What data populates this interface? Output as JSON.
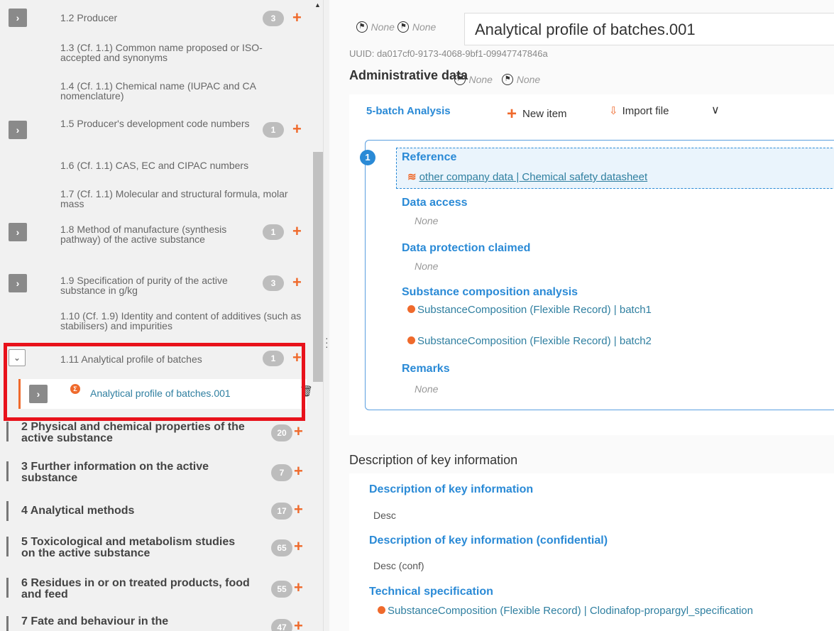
{
  "tree": {
    "nodes": [
      {
        "id": "n12",
        "label": "1.2 Producer",
        "count": "3",
        "expandable": true
      },
      {
        "id": "n13",
        "label": "1.3 (Cf. 1.1) Common name proposed or ISO-accepted and synonyms"
      },
      {
        "id": "n14",
        "label": "1.4 (Cf. 1.1) Chemical name (IUPAC and CA nomenclature)"
      },
      {
        "id": "n15",
        "label": "1.5 Producer's development code numbers",
        "count": "1",
        "expandable": true
      },
      {
        "id": "n16",
        "label": "1.6 (Cf. 1.1) CAS, EC and CIPAC numbers"
      },
      {
        "id": "n17",
        "label": "1.7 (Cf. 1.1) Molecular and structural formula, molar mass"
      },
      {
        "id": "n18",
        "label": "1.8 Method of manufacture (synthesis pathway) of the active substance",
        "count": "1",
        "expandable": true
      },
      {
        "id": "n19",
        "label": "1.9 Specification of purity of the active substance in g/kg",
        "count": "3",
        "expandable": true
      },
      {
        "id": "n110",
        "label": "1.10 (Cf. 1.9) Identity and content of additives (such as stabilisers) and impurities"
      },
      {
        "id": "n111",
        "label": "1.11 Analytical profile of batches",
        "count": "1",
        "expandable": true,
        "open": true
      }
    ],
    "child": {
      "label": "Analytical profile of batches.001",
      "icon": "sigma-icon"
    },
    "sections": [
      {
        "label": "2 Physical and chemical properties of the active substance",
        "count": "20"
      },
      {
        "label": "3 Further information on the active substance",
        "count": "7"
      },
      {
        "label": "4 Analytical methods",
        "count": "17"
      },
      {
        "label": "5 Toxicological and metabolism studies on the active substance",
        "count": "65"
      },
      {
        "label": "6 Residues in or on treated products, food and feed",
        "count": "55"
      },
      {
        "label": "7 Fate and behaviour in the",
        "count": "47"
      }
    ]
  },
  "header": {
    "flag1": "None",
    "flag2": "None",
    "title": "Analytical profile of batches.001",
    "uuid": "UUID: da017cf0-9173-4068-9bf1-09947747846a"
  },
  "admin": {
    "title": "Administrative data",
    "flag1": "None",
    "flag2": "None",
    "tab": "5-batch Analysis",
    "new_item": "New item",
    "import_file": "Import file",
    "entry_number": "1",
    "reference_label": "Reference",
    "reference_value": "other company data | Chemical safety datasheet",
    "data_access_label": "Data access",
    "data_access_value": "None",
    "data_protection_label": "Data protection claimed",
    "data_protection_value": "None",
    "composition_label": "Substance composition analysis",
    "composition_1": "SubstanceComposition (Flexible Record) | batch1",
    "composition_2": "SubstanceComposition (Flexible Record) | batch2",
    "remarks_label": "Remarks",
    "remarks_value": "None"
  },
  "description": {
    "section_title": "Description of key information",
    "key_label": "Description of key information",
    "key_value": "Desc",
    "conf_label": "Description of key information (confidential)",
    "conf_value": "Desc (conf)",
    "tech_label": "Technical specification",
    "tech_value": "SubstanceComposition (Flexible Record) | Clodinafop-propargyl_specification"
  },
  "colors": {
    "accent": "#2a8ad6",
    "plus": "#ef6a2c",
    "highlight": "#e8121b",
    "link": "#2f7fa0"
  }
}
